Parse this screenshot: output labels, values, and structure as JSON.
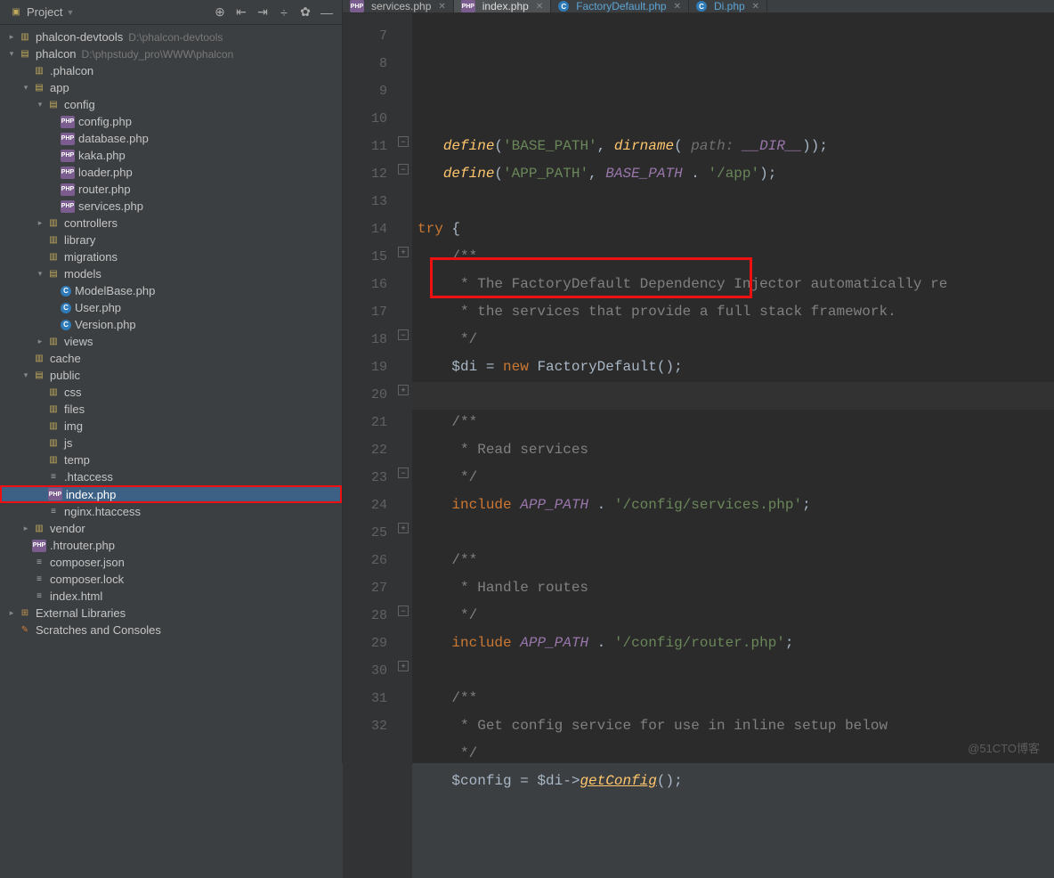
{
  "sidebar": {
    "title": "Project",
    "icons": [
      "target-icon",
      "collapse-icon",
      "expand-icon",
      "divide-icon",
      "gear-icon",
      "hide-icon"
    ]
  },
  "tree": [
    {
      "d": 0,
      "arrow": ">",
      "icon": "dir",
      "label": "phalcon-devtools",
      "hint": "D:\\phalcon-devtools"
    },
    {
      "d": 0,
      "arrow": "v",
      "icon": "dir-open",
      "label": "phalcon",
      "hint": "D:\\phpstudy_pro\\WWW\\phalcon"
    },
    {
      "d": 1,
      "arrow": "",
      "icon": "dir",
      "label": ".phalcon"
    },
    {
      "d": 1,
      "arrow": "v",
      "icon": "dir-open",
      "label": "app"
    },
    {
      "d": 2,
      "arrow": "v",
      "icon": "dir-open",
      "label": "config"
    },
    {
      "d": 3,
      "arrow": "",
      "icon": "php",
      "label": "config.php"
    },
    {
      "d": 3,
      "arrow": "",
      "icon": "php",
      "label": "database.php"
    },
    {
      "d": 3,
      "arrow": "",
      "icon": "php",
      "label": "kaka.php"
    },
    {
      "d": 3,
      "arrow": "",
      "icon": "php",
      "label": "loader.php"
    },
    {
      "d": 3,
      "arrow": "",
      "icon": "php",
      "label": "router.php"
    },
    {
      "d": 3,
      "arrow": "",
      "icon": "php",
      "label": "services.php"
    },
    {
      "d": 2,
      "arrow": ">",
      "icon": "dir",
      "label": "controllers"
    },
    {
      "d": 2,
      "arrow": "",
      "icon": "dir",
      "label": "library"
    },
    {
      "d": 2,
      "arrow": "",
      "icon": "dir",
      "label": "migrations"
    },
    {
      "d": 2,
      "arrow": "v",
      "icon": "dir-open",
      "label": "models"
    },
    {
      "d": 3,
      "arrow": "",
      "icon": "c",
      "label": "ModelBase.php"
    },
    {
      "d": 3,
      "arrow": "",
      "icon": "c",
      "label": "User.php"
    },
    {
      "d": 3,
      "arrow": "",
      "icon": "c",
      "label": "Version.php"
    },
    {
      "d": 2,
      "arrow": ">",
      "icon": "dir",
      "label": "views"
    },
    {
      "d": 1,
      "arrow": "",
      "icon": "dir",
      "label": "cache"
    },
    {
      "d": 1,
      "arrow": "v",
      "icon": "dir-open",
      "label": "public"
    },
    {
      "d": 2,
      "arrow": "",
      "icon": "dir",
      "label": "css"
    },
    {
      "d": 2,
      "arrow": "",
      "icon": "dir",
      "label": "files"
    },
    {
      "d": 2,
      "arrow": "",
      "icon": "dir",
      "label": "img"
    },
    {
      "d": 2,
      "arrow": "",
      "icon": "dir",
      "label": "js"
    },
    {
      "d": 2,
      "arrow": "",
      "icon": "dir",
      "label": "temp"
    },
    {
      "d": 2,
      "arrow": "",
      "icon": "file",
      "label": ".htaccess"
    },
    {
      "d": 2,
      "arrow": "",
      "icon": "php",
      "label": "index.php",
      "selected": true,
      "redbox": true
    },
    {
      "d": 2,
      "arrow": "",
      "icon": "file",
      "label": "nginx.htaccess"
    },
    {
      "d": 1,
      "arrow": ">",
      "icon": "dir",
      "label": "vendor"
    },
    {
      "d": 1,
      "arrow": "",
      "icon": "php",
      "label": ".htrouter.php"
    },
    {
      "d": 1,
      "arrow": "",
      "icon": "file",
      "label": "composer.json"
    },
    {
      "d": 1,
      "arrow": "",
      "icon": "file",
      "label": "composer.lock"
    },
    {
      "d": 1,
      "arrow": "",
      "icon": "file",
      "label": "index.html"
    },
    {
      "d": 0,
      "arrow": ">",
      "icon": "lib",
      "label": "External Libraries"
    },
    {
      "d": 0,
      "arrow": "",
      "icon": "scr",
      "label": "Scratches and Consoles"
    }
  ],
  "tabs": [
    {
      "icon": "php",
      "label": "services.php"
    },
    {
      "icon": "php",
      "label": "index.php",
      "active": true
    },
    {
      "icon": "c",
      "label": "FactoryDefault.php",
      "cname": true
    },
    {
      "icon": "c",
      "label": "Di.php",
      "cname": true
    }
  ],
  "lines": [
    "7",
    "8",
    "9",
    "10",
    "11",
    "12",
    "13",
    "14",
    "15",
    "16",
    "17",
    "18",
    "19",
    "20",
    "21",
    "22",
    "23",
    "24",
    "25",
    "26",
    "27",
    "28",
    "29",
    "30",
    "31",
    "32"
  ],
  "code": {
    "l8_def": "define",
    "l8_s1": "'BASE_PATH'",
    "l8_dir": "dirname",
    "l8_hint": " path: ",
    "l8_dirconst": "__DIR__",
    "l9_def": "define",
    "l9_s1": "'APP_PATH'",
    "l9_bp": "BASE_PATH",
    "l9_s2": "'/app'",
    "l11": "try",
    "l12": "/**",
    "l13": " * The FactoryDefault Dependency Injector automatically re",
    "l14": " * the services that provide a full stack framework.",
    "l15": " */",
    "l16_var": "$di",
    "l16_new": "new",
    "l16_cls": "FactoryDefault",
    "l18": "/**",
    "l19": " * Read services",
    "l20": " */",
    "l21_inc": "include",
    "l21_ap": "APP_PATH",
    "l21_s": "'/config/services.php'",
    "l23": "/**",
    "l24": " * Handle routes",
    "l25": " */",
    "l26_inc": "include",
    "l26_ap": "APP_PATH",
    "l26_s": "'/config/router.php'",
    "l28": "/**",
    "l29": " * Get config service for use in inline setup below",
    "l30": " */",
    "l31_var": "$config",
    "l31_di": "$di",
    "l31_m": "getConfig"
  },
  "watermark": "@51CTO博客"
}
